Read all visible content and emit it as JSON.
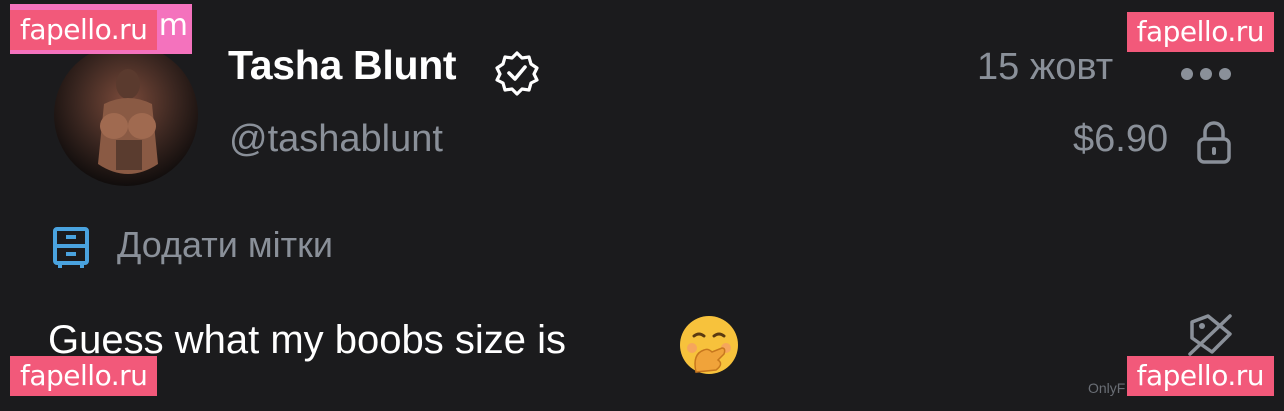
{
  "watermarks": {
    "top_left": "fapello.ru",
    "top_left_behind": "m",
    "top_right": "fapello.ru",
    "bottom_left": "fapello.ru",
    "bottom_right": "fapello.ru"
  },
  "post": {
    "author_name": "Tasha Blunt",
    "author_handle": "@tashablunt",
    "date": "15 жовт",
    "price": "$6.90",
    "add_tags_label": "Додати мітки",
    "caption": "Guess what my boobs size is",
    "caption_emoji": "🤭"
  },
  "footer": {
    "text": "OnlyF"
  },
  "icons": {
    "verified": "verified-badge-icon",
    "more": "more-dots-icon",
    "lock": "lock-icon",
    "tags": "tags-icon",
    "tip": "tip-icon"
  },
  "colors": {
    "background": "#1b1b1d",
    "muted_text": "#8a9099",
    "accent_blue": "#4aa3df",
    "watermark": "#f2597a"
  }
}
